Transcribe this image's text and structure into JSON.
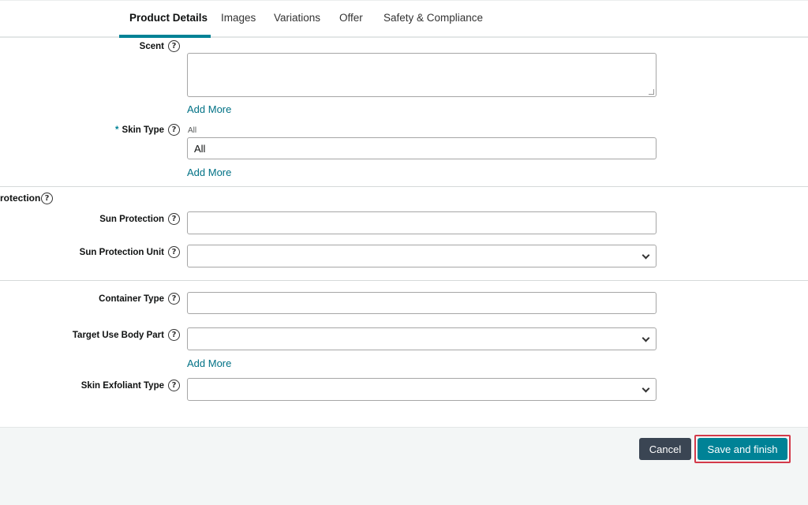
{
  "tabs": [
    {
      "label": "Product Details",
      "active": true
    },
    {
      "label": "Images"
    },
    {
      "label": "Variations"
    },
    {
      "label": "Offer"
    },
    {
      "label": "Safety & Compliance"
    }
  ],
  "fields": {
    "scent": {
      "label": "Scent",
      "value": ""
    },
    "skin_type": {
      "label": "Skin Type",
      "required_mark": "*",
      "current_hint": "All",
      "value": "All"
    },
    "sun_protection_section": {
      "title": "rotection"
    },
    "sun_protection": {
      "label": "Sun Protection",
      "value": ""
    },
    "sun_protection_unit": {
      "label": "Sun Protection Unit",
      "value": ""
    },
    "container_type": {
      "label": "Container Type",
      "value": ""
    },
    "target_use_body_part": {
      "label": "Target Use Body Part",
      "value": ""
    },
    "skin_exfoliant_type": {
      "label": "Skin Exfoliant Type",
      "value": ""
    }
  },
  "add_more_label": "Add More",
  "help_glyph": "?",
  "footer": {
    "cancel_label": "Cancel",
    "save_label": "Save and finish"
  },
  "colors": {
    "accent": "#008296",
    "link": "#007185",
    "cancel_bg": "#3a4553",
    "highlight_outline": "#d33a4a"
  }
}
